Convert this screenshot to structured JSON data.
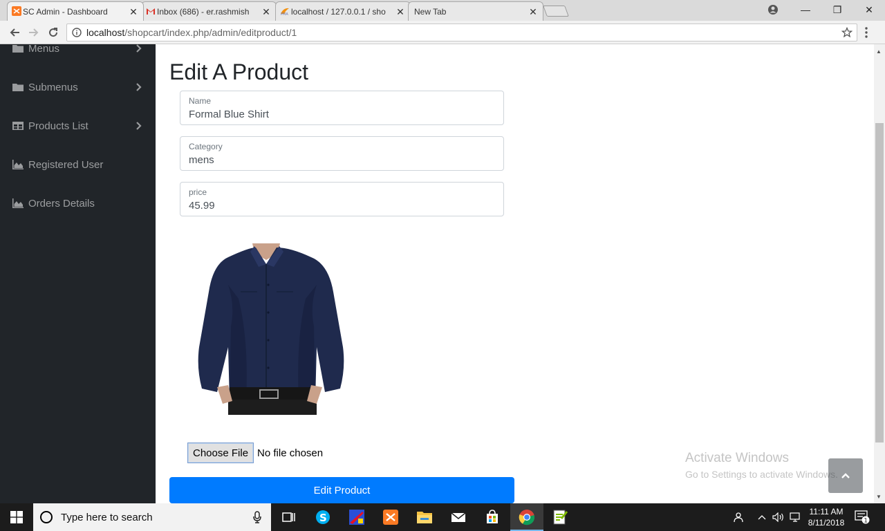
{
  "browser": {
    "tabs": [
      {
        "title": "SC Admin - Dashboard",
        "icon": "xampp-icon",
        "active": true
      },
      {
        "title": "Inbox (686) - er.rashmish",
        "icon": "gmail-icon",
        "active": false
      },
      {
        "title": "localhost / 127.0.0.1 / sho",
        "icon": "phpmyadmin-icon",
        "active": false
      },
      {
        "title": "New Tab",
        "icon": "",
        "active": false
      }
    ],
    "url_host": "localhost",
    "url_path": "/shopcart/index.php/admin/editproduct/1"
  },
  "sidebar": {
    "items": [
      {
        "label": "Menus",
        "icon": "folder-icon",
        "has_caret": true
      },
      {
        "label": "Submenus",
        "icon": "folder-icon",
        "has_caret": true
      },
      {
        "label": "Products List",
        "icon": "table-icon",
        "has_caret": true
      },
      {
        "label": "Registered User",
        "icon": "area-chart-icon",
        "has_caret": false
      },
      {
        "label": "Orders Details",
        "icon": "area-chart-icon",
        "has_caret": false
      }
    ]
  },
  "main": {
    "title": "Edit A Product",
    "fields": {
      "name": {
        "label": "Name",
        "value": "Formal Blue Shirt"
      },
      "category": {
        "label": "Category",
        "value": "mens"
      },
      "price": {
        "label": "price",
        "value": "45.99"
      }
    },
    "file": {
      "button": "Choose File",
      "status": "No file chosen"
    },
    "submit_label": "Edit Product"
  },
  "watermark": {
    "title": "Activate Windows",
    "subtitle": "Go to Settings to activate Windows."
  },
  "taskbar": {
    "search_placeholder": "Type here to search",
    "time": "11:11 AM",
    "date": "8/11/2018",
    "notification_count": "1"
  },
  "colors": {
    "sidebar_bg": "#212529",
    "primary": "#007bff",
    "shirt": "#1f2a4d"
  }
}
